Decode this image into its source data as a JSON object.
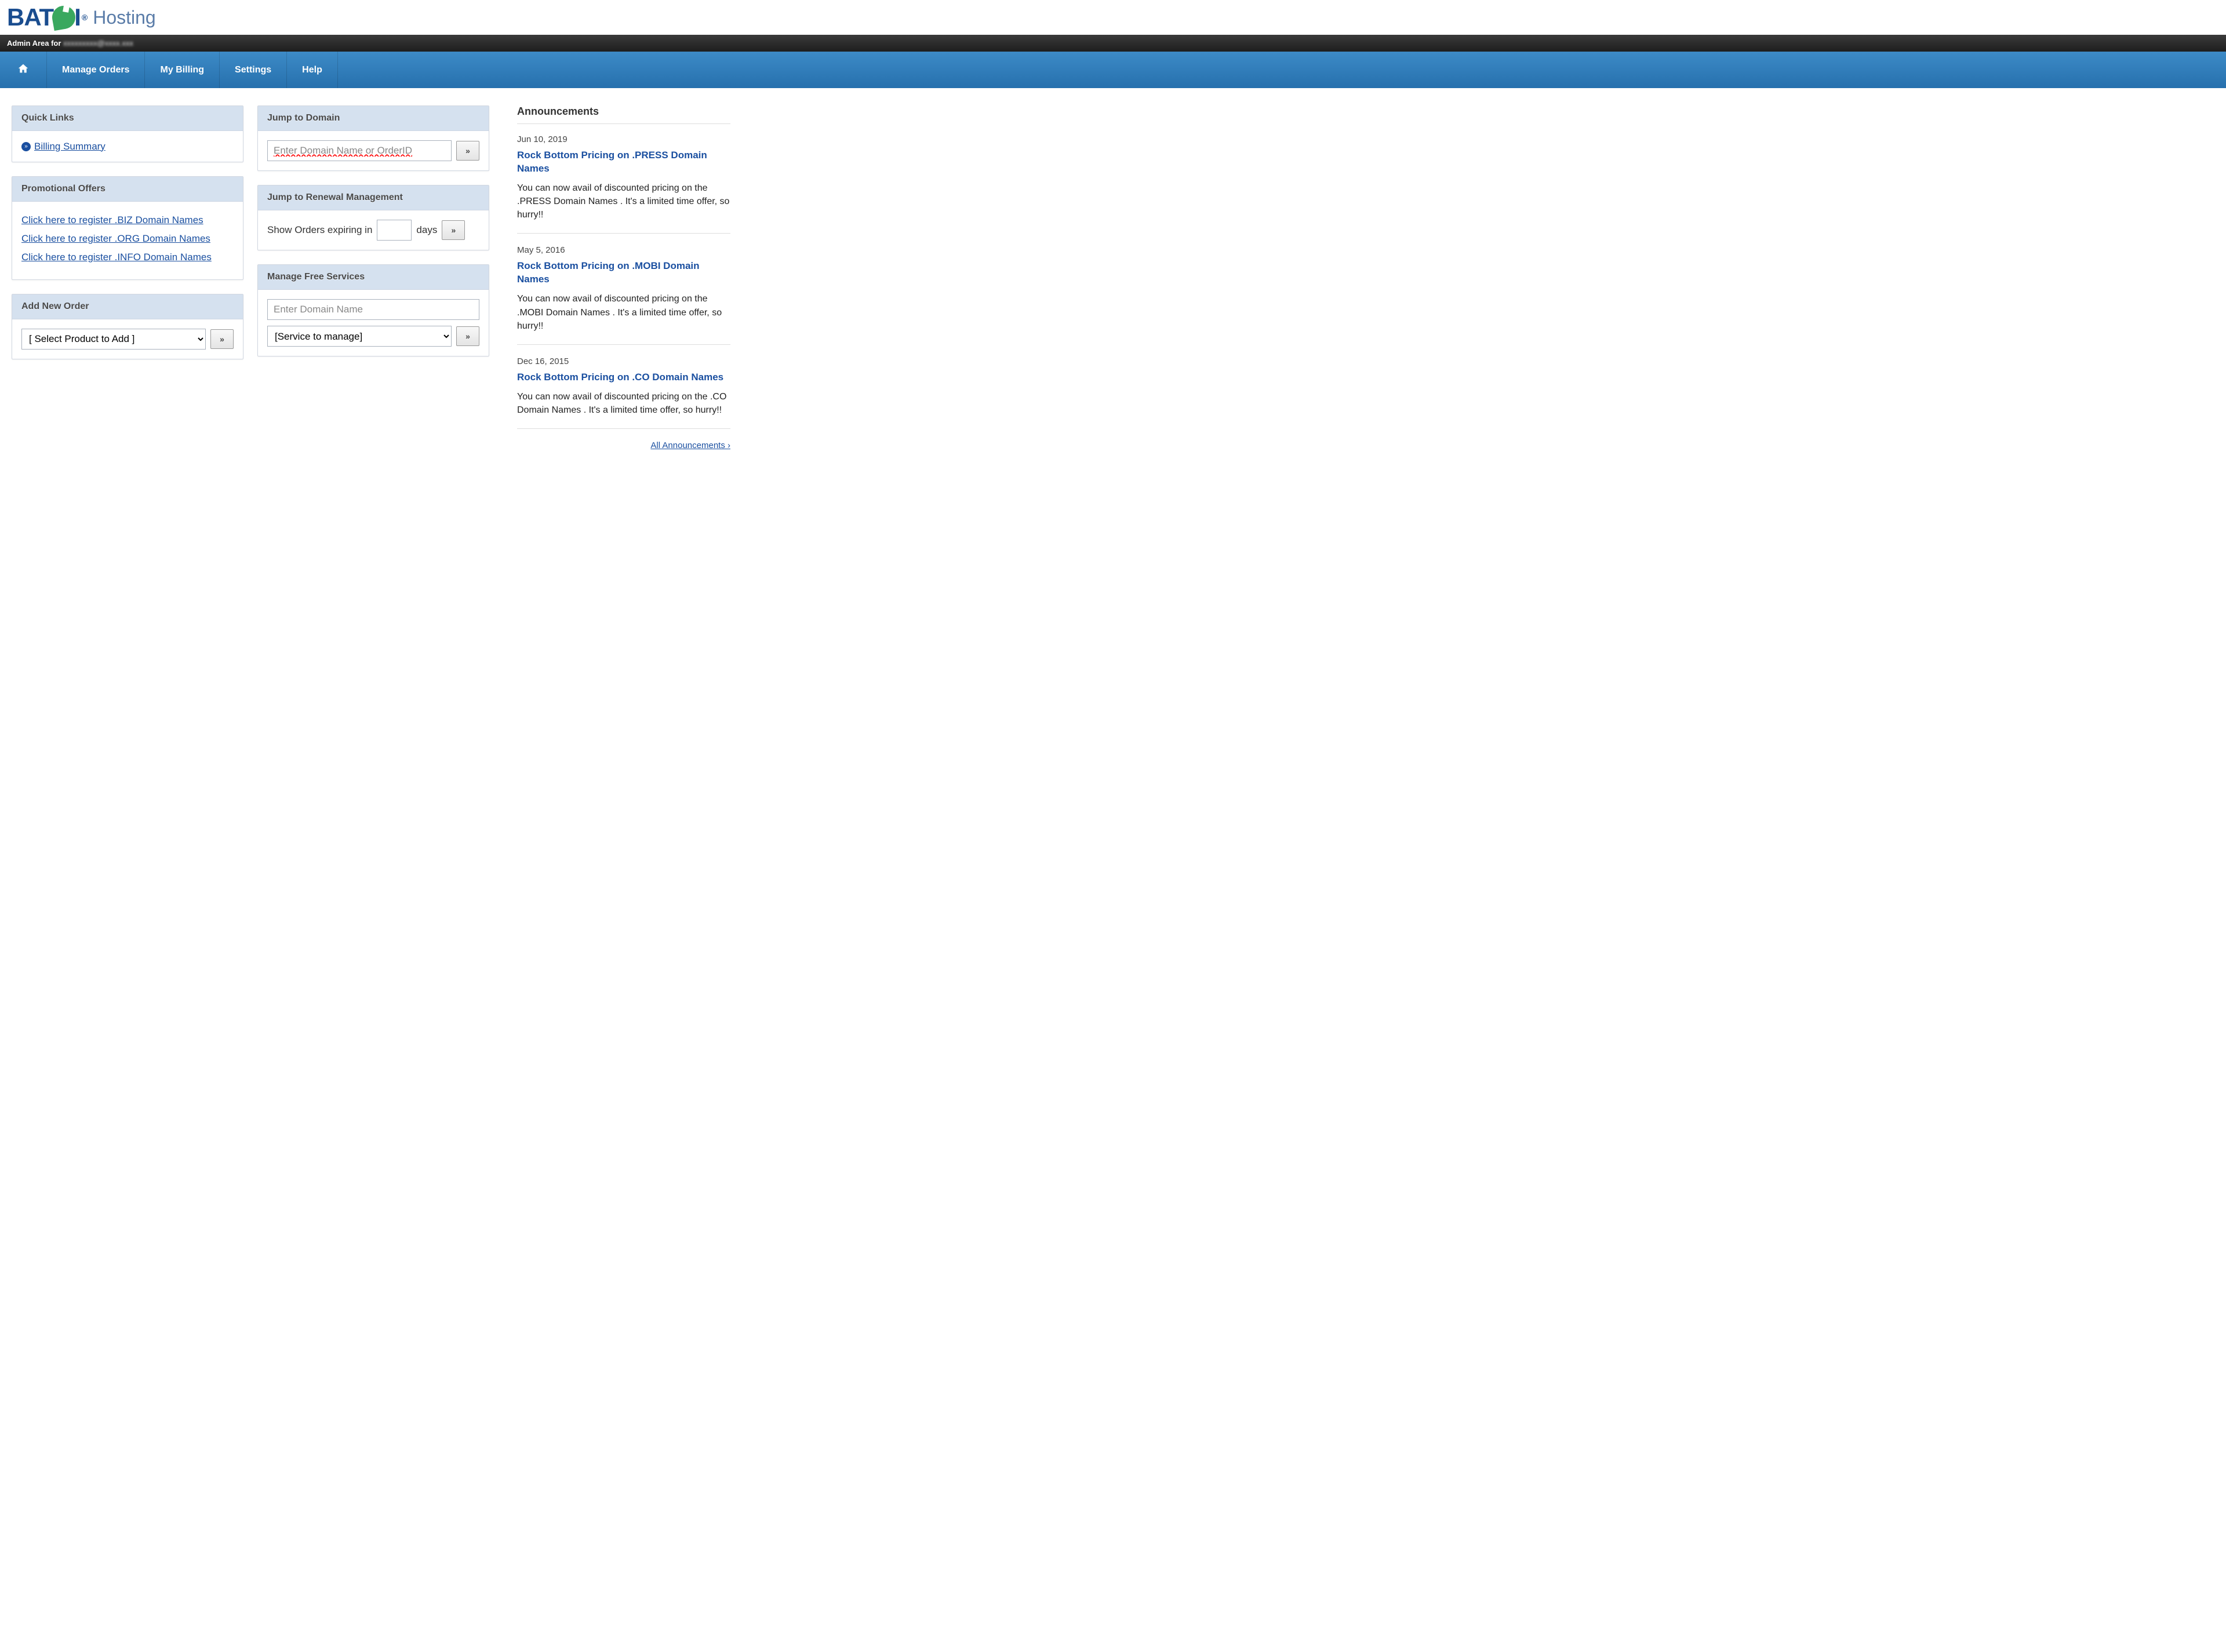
{
  "logo": {
    "brand_left": "BAT",
    "brand_right": "I",
    "registered": "®",
    "suffix": "Hosting"
  },
  "adminBar": {
    "prefix": "Admin Area for",
    "obscured": "xxxxxxxxx@xxxx.xxx"
  },
  "nav": {
    "manage_orders": "Manage Orders",
    "my_billing": "My Billing",
    "settings": "Settings",
    "help": "Help"
  },
  "quickLinks": {
    "title": "Quick Links",
    "billing_summary": "Billing Summary"
  },
  "promo": {
    "title": "Promotional Offers",
    "links": [
      "Click here to register .BIZ Domain Names",
      "Click here to register .ORG Domain Names",
      "Click here to register .INFO Domain Names"
    ]
  },
  "addOrder": {
    "title": "Add New Order",
    "select_placeholder": "[ Select Product to Add ]",
    "go": "»"
  },
  "jumpDomain": {
    "title": "Jump to Domain",
    "placeholder": "Enter Domain Name or OrderID",
    "go": "»"
  },
  "renewal": {
    "title": "Jump to Renewal Management",
    "label_prefix": "Show Orders expiring in",
    "label_suffix": "days",
    "go": "»"
  },
  "freeServices": {
    "title": "Manage Free Services",
    "domain_placeholder": "Enter Domain Name",
    "service_placeholder": "[Service to manage]",
    "go": "»"
  },
  "announcements": {
    "title": "Announcements",
    "items": [
      {
        "date": "Jun 10, 2019",
        "title": "Rock Bottom Pricing on .PRESS Domain Names",
        "body": "You can now avail of discounted pricing on the .PRESS Domain Names . It's a limited time offer, so hurry!!"
      },
      {
        "date": "May 5, 2016",
        "title": "Rock Bottom Pricing on .MOBI Domain Names",
        "body": "You can now avail of discounted pricing on the .MOBI Domain Names . It's a limited time offer, so hurry!!"
      },
      {
        "date": "Dec 16, 2015",
        "title": "Rock Bottom Pricing on .CO Domain Names",
        "body": "You can now avail of discounted pricing on the .CO Domain Names . It's a limited time offer, so hurry!!"
      }
    ],
    "all_link": "All Announcements ›"
  }
}
